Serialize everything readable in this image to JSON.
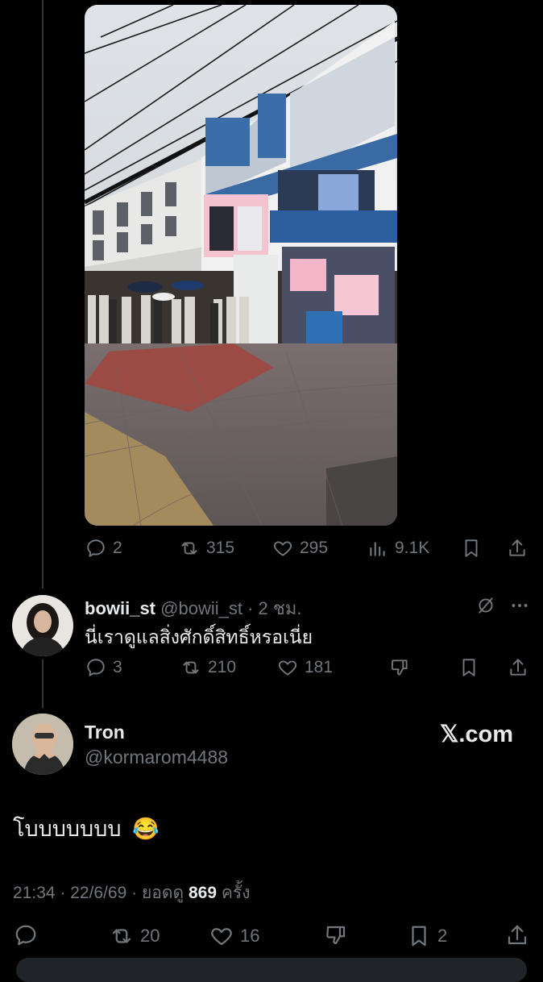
{
  "tweet_actions": {
    "replies": "2",
    "reposts": "315",
    "likes": "295",
    "views": "9.1K"
  },
  "reply": {
    "display_name": "bowii_st",
    "handle": "@bowii_st",
    "separator": "·",
    "time": "2 ชม.",
    "text": "นี่เราดูแลสิ่งศักดิ์สิทธิ์หรอเนี่ย",
    "replies": "3",
    "reposts": "210",
    "likes": "181"
  },
  "main": {
    "display_name": "Tron",
    "handle": "@kormarom4488",
    "brand": "𝕏.com",
    "text": "โบบบบบบบ",
    "emoji": "😂",
    "timestamp": "21:34 · 22/6/69 · ยอดดู",
    "views": "869",
    "views_suffix": "ครั้ง",
    "reposts": "20",
    "likes": "16",
    "bookmarks": "2"
  },
  "colors": {
    "background": "#000000",
    "muted": "#71767b",
    "text": "#e7e9ea"
  }
}
